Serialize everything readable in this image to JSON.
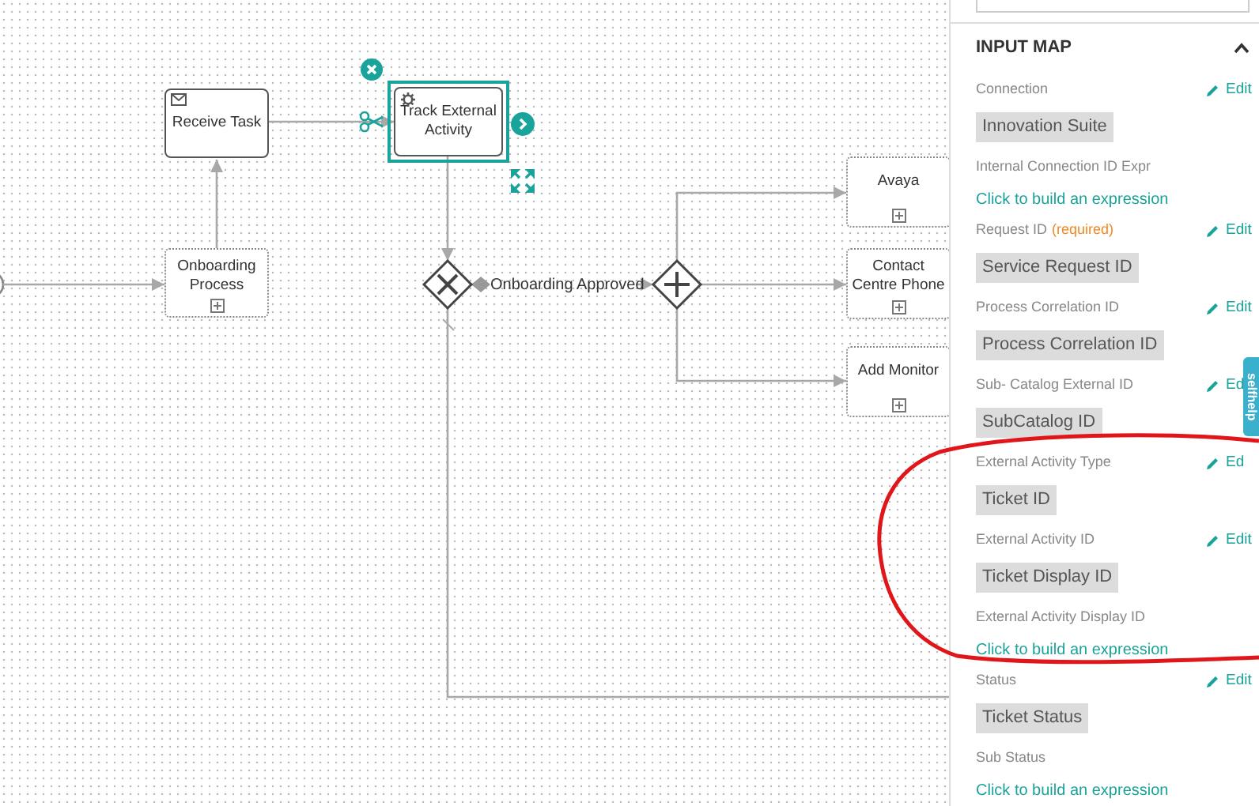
{
  "diagram": {
    "nodes": [
      {
        "kind": "receive_task",
        "label": "Receive Task",
        "selected": false
      },
      {
        "kind": "subprocess",
        "label": "Onboarding Process",
        "selected": false
      },
      {
        "kind": "service_task",
        "label": "Track External Activity",
        "selected": true
      },
      {
        "kind": "exclusive_gateway",
        "selected": false
      },
      {
        "kind": "parallel_gateway",
        "selected": false
      },
      {
        "kind": "subprocess",
        "label": "Avaya",
        "selected": false
      },
      {
        "kind": "subprocess",
        "label": "Contact Centre Phone",
        "selected": false
      },
      {
        "kind": "subprocess",
        "label": "Add Monitor",
        "selected": false
      }
    ],
    "flows": [
      {
        "label": "Onboarding Approved"
      }
    ]
  },
  "side_tab": {
    "label": "selfhelp"
  },
  "input_map": {
    "title": "INPUT MAP",
    "expanded": true,
    "fields": [
      {
        "label": "Connection",
        "edit": "Edit",
        "kind": "value",
        "value": "Innovation Suite"
      },
      {
        "label": "Internal Connection ID Expr",
        "kind": "expression",
        "value": "Click to build an expression"
      },
      {
        "label": "Request ID",
        "required_note": "(required)",
        "edit": "Edit",
        "kind": "value",
        "value": "Service Request ID"
      },
      {
        "label": "Process Correlation ID",
        "edit": "Edit",
        "kind": "value",
        "value": "Process Correlation ID"
      },
      {
        "label": "Sub- Catalog External ID",
        "edit": "Ed",
        "kind": "value",
        "value": "SubCatalog ID"
      },
      {
        "label": "External Activity Type",
        "edit": "Ed",
        "kind": "value",
        "value": "Ticket ID"
      },
      {
        "label": "External Activity ID",
        "edit": "Edit",
        "kind": "value",
        "value": "Ticket Display ID"
      },
      {
        "label": "External Activity Display ID",
        "kind": "expression",
        "value": "Click to build an expression"
      },
      {
        "label": "Status",
        "edit": "Edit",
        "kind": "value",
        "value": "Ticket Status"
      },
      {
        "label": "Sub Status",
        "kind": "expression",
        "value": "Click to build an expression"
      }
    ]
  }
}
